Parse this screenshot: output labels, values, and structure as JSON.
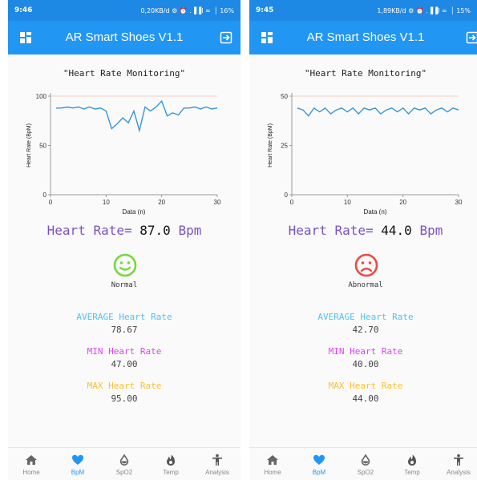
{
  "screens": [
    {
      "status": {
        "time": "9:46",
        "right": "0,20KB/d ⚙ ⏰ .▐▐l ≈  │ 16%"
      },
      "appbar": {
        "title": "AR Smart Shoes V1.1"
      },
      "monitor_title": "\"Heart Rate Monitoring\"",
      "hr_label": "Heart Rate=",
      "hr_value": "87.0",
      "hr_unit": "Bpm",
      "state": "Normal",
      "face": "smile-face-icon",
      "avg_label": "AVERAGE Heart Rate",
      "avg_value": "78.67",
      "min_label": "MIN Heart Rate",
      "min_value": "47.00",
      "max_label": "MAX Heart Rate",
      "max_value": "95.00"
    },
    {
      "status": {
        "time": "9:45",
        "right": "1,89KB/d ⚙ ⏰ .▐▐l ≈  │ 15%"
      },
      "appbar": {
        "title": "AR Smart Shoes V1.1"
      },
      "monitor_title": "\"Heart Rate Monitoring\"",
      "hr_label": "Heart Rate=",
      "hr_value": "44.0",
      "hr_unit": "Bpm",
      "state": "Abnormal",
      "face": "sad-face-icon",
      "avg_label": "AVERAGE Heart Rate",
      "avg_value": "42.70",
      "min_label": "MIN Heart Rate",
      "min_value": "40.00",
      "max_label": "MAX Heart Rate",
      "max_value": "44.00"
    }
  ],
  "nav": [
    {
      "label": "Home",
      "icon": "home-icon"
    },
    {
      "label": "BpM",
      "icon": "heart-icon",
      "active": true
    },
    {
      "label": "SpO2",
      "icon": "drop-icon"
    },
    {
      "label": "Temp",
      "icon": "flame-icon"
    },
    {
      "label": "Analysis",
      "icon": "person-icon"
    }
  ],
  "colors": {
    "appbar": "#2196f3",
    "statusbar": "#1e88e5",
    "line": "#3a95d8",
    "hr_label": "#7b52c4",
    "avg": "#4fc3f7",
    "min": "#e040fb",
    "max": "#fbc02d",
    "normal_face": "#76d83b",
    "abnormal_face": "#ee4a43"
  },
  "chart_data": [
    {
      "type": "line",
      "xlabel": "Data (n)",
      "ylabel": "Heart Rate (BpM)",
      "xlim": [
        0,
        30
      ],
      "ylim": [
        0,
        100
      ],
      "xticks": [
        "0",
        "10",
        "20",
        "30"
      ],
      "yticks": [
        "0",
        "50",
        "100"
      ],
      "series": [
        {
          "x": [
            1,
            2,
            3,
            4,
            5,
            6,
            7,
            8,
            9,
            10,
            11,
            12,
            13,
            14,
            15,
            16,
            17,
            18,
            19,
            20,
            21,
            22,
            23,
            24,
            25,
            26,
            27,
            28,
            29,
            30
          ],
          "values": [
            88,
            88,
            89,
            88,
            89,
            87,
            89,
            87,
            88,
            85,
            67,
            72,
            78,
            73,
            85,
            65,
            89,
            85,
            89,
            95,
            80,
            83,
            81,
            88,
            88,
            89,
            87,
            89,
            87,
            88
          ]
        }
      ]
    },
    {
      "type": "line",
      "xlabel": "Data (n)",
      "ylabel": "Heart Rate (BpM)",
      "xlim": [
        0,
        30
      ],
      "ylim": [
        0,
        50
      ],
      "xticks": [
        "0",
        "10",
        "20",
        "30"
      ],
      "yticks": [
        "0",
        "25",
        "50"
      ],
      "series": [
        {
          "x": [
            1,
            2,
            3,
            4,
            5,
            6,
            7,
            8,
            9,
            10,
            11,
            12,
            13,
            14,
            15,
            16,
            17,
            18,
            19,
            20,
            21,
            22,
            23,
            24,
            25,
            26,
            27,
            28,
            29,
            30
          ],
          "values": [
            44,
            43,
            40,
            44,
            42,
            44,
            41,
            43,
            44,
            42,
            44,
            41,
            44,
            43,
            44,
            41,
            43,
            44,
            42,
            44,
            41,
            44,
            43,
            44,
            41,
            43,
            44,
            42,
            44,
            43
          ]
        }
      ]
    }
  ]
}
